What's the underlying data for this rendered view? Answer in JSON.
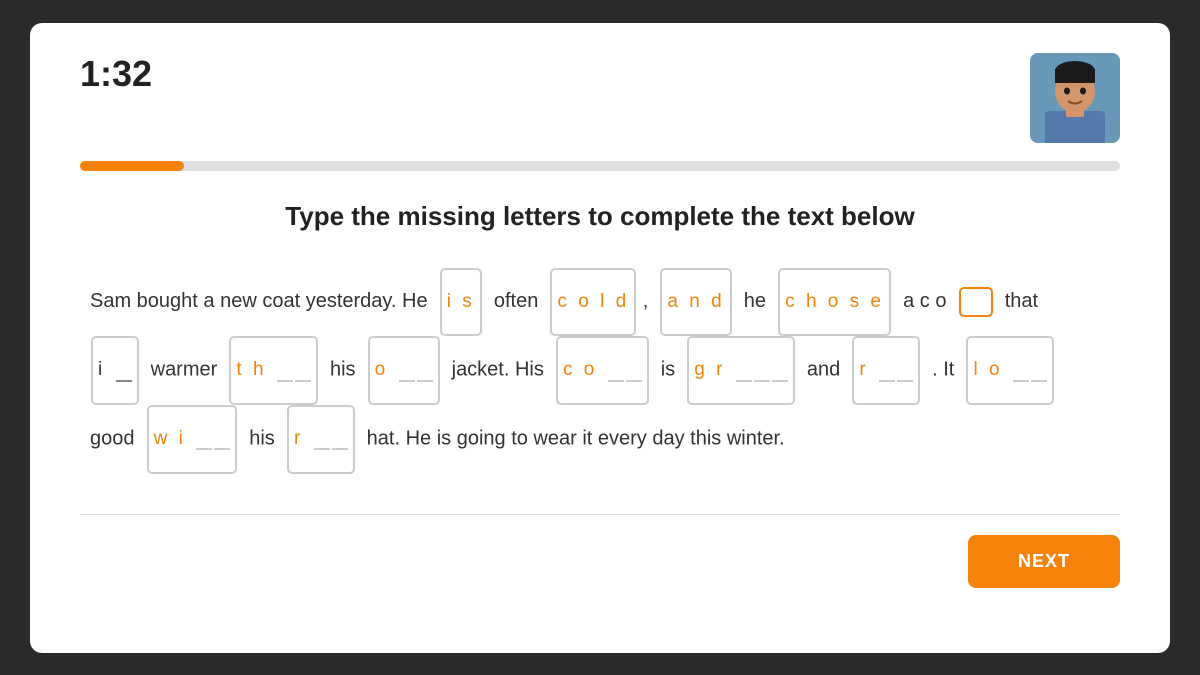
{
  "timer": "1:32",
  "progress": {
    "percent": 10,
    "label": "progress"
  },
  "instruction": "Type the missing letters to complete the text below",
  "next_button": "NEXT",
  "text": {
    "line1": {
      "before": "Sam bought a new coat yesterday. He ",
      "box1": {
        "letters": "i s",
        "style": "orange"
      },
      "mid1": " often ",
      "box2": {
        "letters": "c o l d",
        "style": "orange"
      },
      "mid2": ",",
      "box3": {
        "letters": "a n d",
        "style": "orange"
      },
      "mid3": " he ",
      "box4": {
        "letters": "c h o s e",
        "style": "orange"
      },
      "mid4": " a  c o ",
      "box5": {
        "style": "cursor"
      },
      "after": "  that"
    },
    "line2": {
      "box1": {
        "letter": "i",
        "blank": true
      },
      "mid1": " warmer ",
      "box2": {
        "letters": "t h",
        "blank": true,
        "style": "orange"
      },
      "mid2": " his ",
      "box3": {
        "letter": "o",
        "blank": true,
        "style": "orange"
      },
      "mid3": " jacket.  His ",
      "box4": {
        "letters": "c o",
        "blank": true,
        "style": "orange"
      },
      "mid4": " is ",
      "box5": {
        "letters": "g r",
        "blank": true,
        "style": "orange"
      },
      "mid5": " and ",
      "box6": {
        "letter": "r",
        "blank": true,
        "style": "orange"
      },
      "mid6": " . It ",
      "box7": {
        "letters": "l o",
        "blank": true,
        "style": "orange"
      }
    },
    "line3": {
      "before": "good ",
      "box1": {
        "letters": "w i",
        "blank": true,
        "style": "orange"
      },
      "mid1": " his ",
      "box2": {
        "letter": "r",
        "blank": true,
        "style": "orange"
      },
      "after": "  hat. He is going to wear it every day this winter."
    }
  },
  "colors": {
    "orange": "#f5820a",
    "border": "#ccc",
    "text": "#333"
  }
}
